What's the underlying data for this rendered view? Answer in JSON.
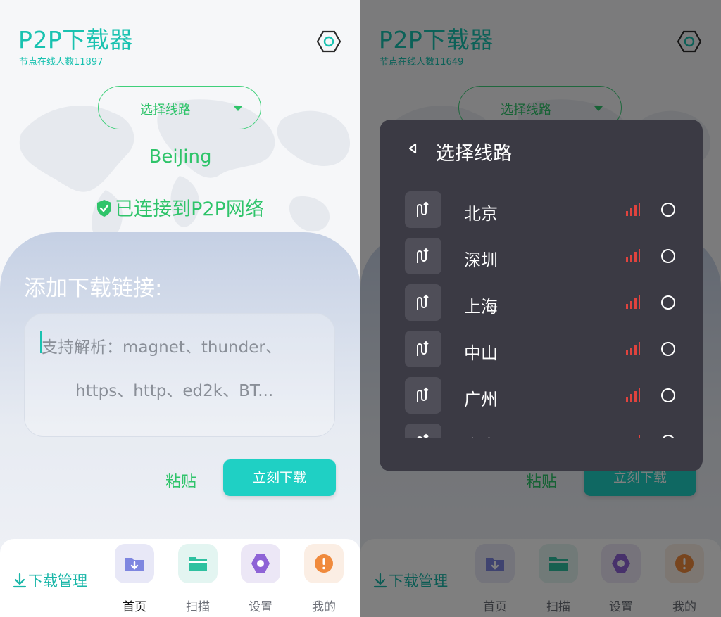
{
  "left": {
    "app_title": "P2P下载器",
    "online_text": "节点在线人数11897",
    "route_button_label": "选择线路",
    "city": "BeiJing",
    "connected_status": "已连接到P2P网络",
    "add_link_title": "添加下载链接:",
    "link_placeholder_line1": "支持解析：magnet、thunder、",
    "link_placeholder_line2": "https、http、ed2k、BT...",
    "paste_label": "粘贴",
    "download_now_label": "立刻下载",
    "download_manage_label": "下载管理",
    "nav": [
      {
        "label": "首页",
        "icon": "download-folder-icon",
        "active": true
      },
      {
        "label": "扫描",
        "icon": "folder-icon"
      },
      {
        "label": "设置",
        "icon": "settings-icon"
      },
      {
        "label": "我的",
        "icon": "alert-icon"
      }
    ]
  },
  "right": {
    "app_title": "P2P下载器",
    "online_text": "节点在线人数11649",
    "route_button_label": "选择线路",
    "paste_label": "粘贴",
    "download_now_label": "立刻下载",
    "download_manage_label": "下载管理",
    "nav": [
      {
        "label": "首页",
        "icon": "download-folder-icon"
      },
      {
        "label": "扫描",
        "icon": "folder-icon"
      },
      {
        "label": "设置",
        "icon": "settings-icon"
      },
      {
        "label": "我的",
        "icon": "alert-icon"
      }
    ],
    "dialog": {
      "title": "选择线路",
      "routes": [
        {
          "name": "北京"
        },
        {
          "name": "深圳"
        },
        {
          "name": "上海"
        },
        {
          "name": "中山"
        },
        {
          "name": "广州"
        },
        {
          "name": "青岛"
        }
      ]
    }
  },
  "colors": {
    "accent_teal": "#19c2b0",
    "accent_green": "#2fc46a",
    "button_teal": "#1fd0c4",
    "dialog_bg": "#3b3a44",
    "signal_red": "#e0433e"
  }
}
